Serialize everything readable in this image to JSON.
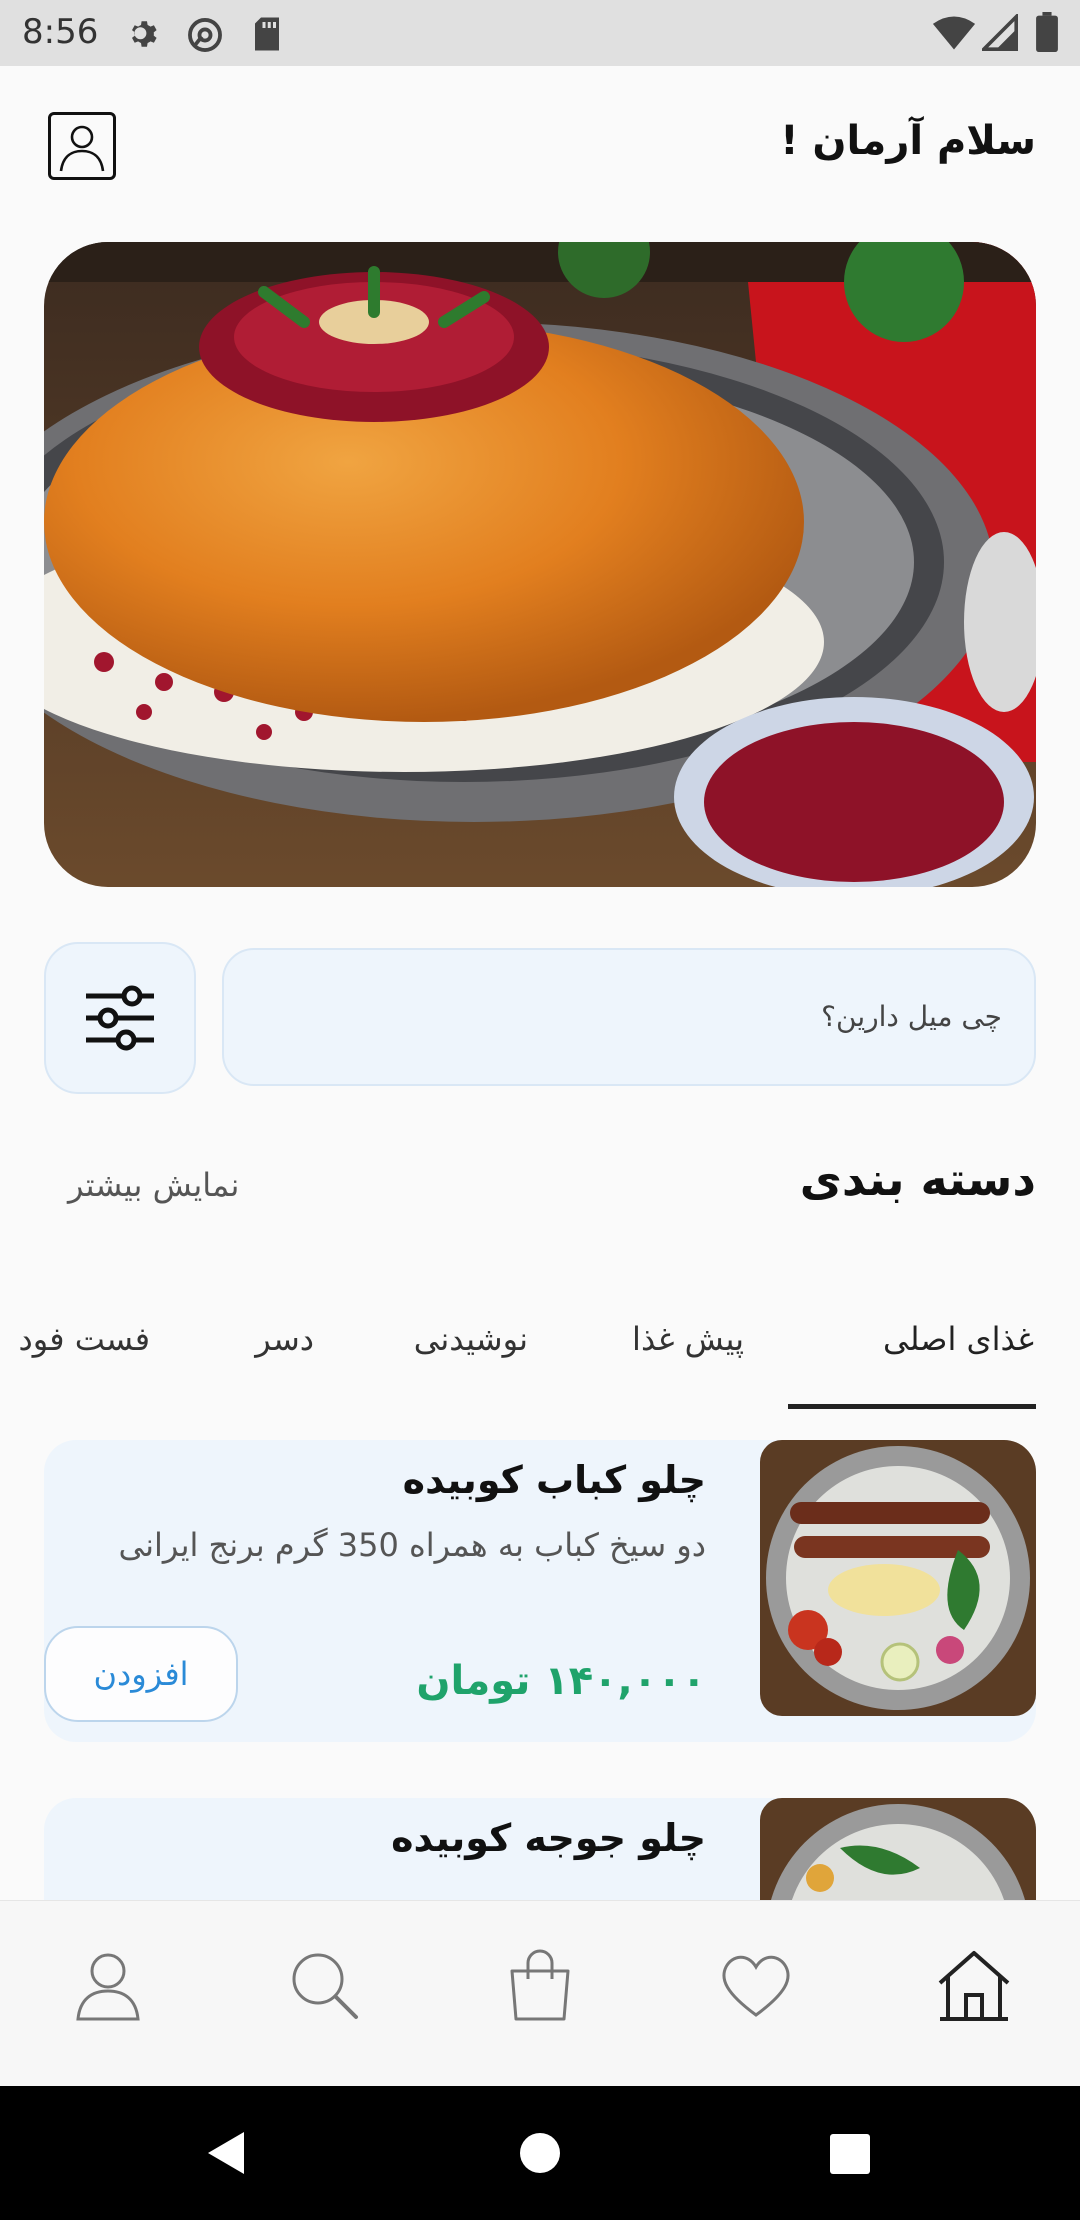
{
  "status_bar": {
    "time": "8:56",
    "left_icons": [
      "settings-icon",
      "at-sign-icon",
      "sd-card-icon"
    ],
    "right_icons": [
      "wifi-icon",
      "signal-icon",
      "battery-icon"
    ]
  },
  "header": {
    "greeting": "سلام آرمان !",
    "profile_icon": "user-outline-icon"
  },
  "hero": {
    "image": "tahchin-rice-dish-photo"
  },
  "search": {
    "placeholder": "چی میل دارین؟",
    "filter_icon": "sliders-icon"
  },
  "categories": {
    "title": "دسته بندی",
    "more_label": "نمایش بیشتر",
    "tabs": [
      "غذای اصلی",
      "پیش غذا",
      "نوشیدنی",
      "دسر",
      "فست فود"
    ],
    "active_tab": "غذای اصلی"
  },
  "foods": [
    {
      "name": "چلو کباب کوبیده",
      "description": "دو سیخ کباب به همراه 350 گرم برنج ایرانی",
      "price": "۱۴۰,۰۰۰ تومان",
      "add_label": "افزودن"
    },
    {
      "name": "چلو جوجه کوبیده"
    }
  ],
  "bottom_nav": {
    "items": [
      "home-icon",
      "heart-icon",
      "shopping-bag-icon",
      "search-icon",
      "user-icon"
    ],
    "active": "home-icon"
  },
  "colors": {
    "accent_green": "#1fa36b",
    "accent_blue": "#2a8ad7",
    "card_bg": "#eef5fc"
  }
}
